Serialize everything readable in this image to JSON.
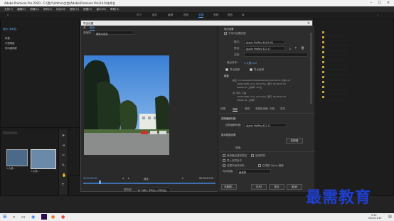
{
  "window": {
    "title": "Adobe Premiere Pro 2020 - C:\\用户\\Admin\\文档\\Adobe\\Premiere Pro\\14.0\\未命名"
  },
  "menu": [
    "文件(F)",
    "编辑(E)",
    "剪辑(C)",
    "序列(S)",
    "标记(M)",
    "图形(G)",
    "视图(V)",
    "窗口(W)",
    "帮助(H)"
  ],
  "workspace_tabs": [
    "学习",
    "组件",
    "编辑",
    "颜色",
    "效果",
    "音频",
    "图形",
    "库"
  ],
  "workspace_active": "效果",
  "project_panel": {
    "tab": "项目: 未命名",
    "items": [
      "风格",
      "不透明度",
      "时间重映射"
    ],
    "clips": [
      "1-大美...",
      "1-大美..."
    ]
  },
  "dialog": {
    "title": "导出设置",
    "source_tab": "源",
    "output_tab": "输出",
    "source_scaling_label": "源缩放:",
    "source_scaling_value": "缩放以适合",
    "export_settings": {
      "heading": "导出设置",
      "match_sequence": "与序列设置匹配",
      "format_label": "格式:",
      "format_value": "Apple ProRes 4444 XQ",
      "preset_label": "预设:",
      "preset_value": "Apple ProRes 422 LT",
      "comments_label": "注释:",
      "output_name_label": "输出名称:",
      "output_name_value": "1-大美.mxf",
      "export_video": "导出视频",
      "export_audio": "导出音频",
      "summary_heading": "摘要",
      "summary_output": "输出: C:\\Users\\Admin\\Desktop\\Premiere Pro\\1-大美.mxf",
      "summary_output_detail": "1920x1080 (1.0), 29.97 fps, 逐行, 00:00:07:01",
      "summary_output_detail2": "48000 Hz, 立体声, 16 位",
      "summary_source": "源: 序列, 大美",
      "summary_source_detail": "1920x1080 (1.0), 29.97 fps, 逐行, 00:00:07:01",
      "summary_source_detail2": "48000 Hz, 立体声"
    },
    "settings_tabs": [
      "效果",
      "视频",
      "音频",
      "多路复用器",
      "字幕",
      "发布"
    ],
    "settings_active": "视频",
    "video_codec_heading": "视频编解码器",
    "video_codec_label": "视频编解码器:",
    "video_codec_value": "Apple ProRes 422 LT",
    "basic_video_heading": "基本视频设置",
    "match_source_button": "匹配源",
    "width_label": "宽度:",
    "checkboxes": [
      "使用最高渲染质量",
      "使用预览",
      "导入到项目中",
      "设置开始时间码",
      "仅渲染 Alpha 通道"
    ],
    "time_interp_label": "时间插值:",
    "time_interp_value": "帧采样",
    "metadata_button": "元数据...",
    "queue_button": "队列",
    "export_button": "导出",
    "cancel_button": "取消",
    "timecode_left": "00:00:00:00",
    "timecode_right": "00:00:07:01",
    "fit_label": "适合",
    "source_range_label": "源范围:",
    "source_range_value": "整个剪辑 / 序列切入/序列切出"
  },
  "timeline_tab": "1-大美",
  "timeline_timecode": "00:00:00:00",
  "taskbar": {
    "time": "9:32",
    "date": "2021/11/19"
  },
  "watermark": "最需教育",
  "colors": {
    "accent": "#4a9ff5",
    "dialog_bg": "#2a2a2a",
    "watermark": "#1f3fd0"
  }
}
